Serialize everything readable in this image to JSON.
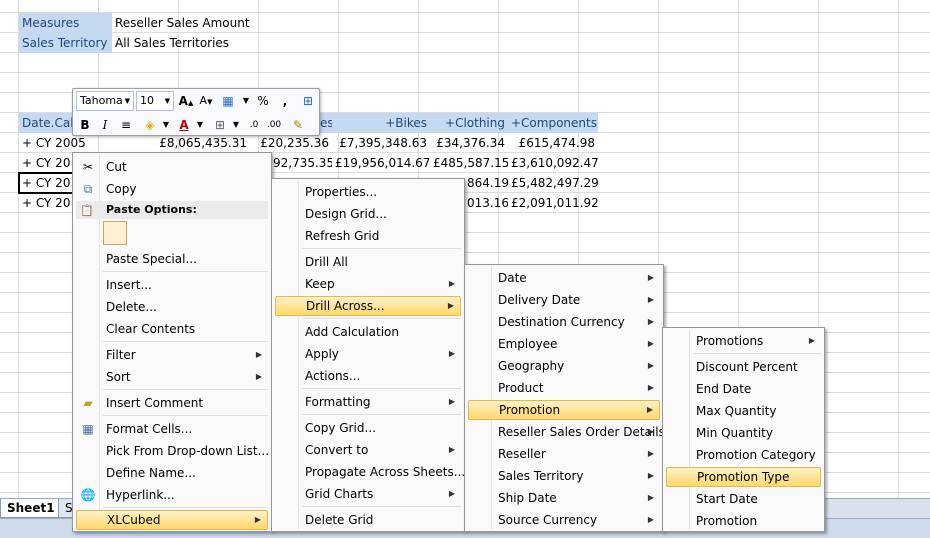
{
  "sheet": {
    "filters": [
      {
        "label": "Measures",
        "value": "Reseller Sales Amount"
      },
      {
        "label": "Sales Territory",
        "value": "All Sales Territories"
      }
    ],
    "header_row": {
      "date_label": "Date.Cale",
      "partial": "es",
      "cols": [
        "+Bikes",
        "+Clothing",
        "+Components"
      ]
    },
    "rows": [
      {
        "label": "+   CY 2005",
        "total": "£8,065,435.31",
        "c1": "£7,395,348.63",
        "c2": "£34,376.34",
        "c3": "£615,474.98"
      },
      {
        "label": "+   CY 20",
        "total": "92,735.35",
        "c1": "£19,956,014.67",
        "c2": "£485,587.15",
        "c3": "£3,610,092.47"
      },
      {
        "label": "+   CY 20",
        "total": "",
        "c1": "",
        "c2": "864.19",
        "c3": "£5,482,497.29"
      },
      {
        "label": "+   CY 20",
        "total": "",
        "c1": "",
        "c2": "013.16",
        "c3": "£2,091,011.92"
      }
    ],
    "partial_total_row1": "£20,235.36"
  },
  "tabs": {
    "active": "Sheet1",
    "other": "S"
  },
  "mini_toolbar": {
    "font": "Tahoma",
    "size": "10",
    "bold": "B",
    "italic": "I",
    "percent": "%",
    "comma": ","
  },
  "context_menu": {
    "cut": "Cut",
    "copy": "Copy",
    "paste_options": "Paste Options:",
    "paste_special": "Paste Special...",
    "insert": "Insert...",
    "delete": "Delete...",
    "clear": "Clear Contents",
    "filter": "Filter",
    "sort": "Sort",
    "insert_comment": "Insert Comment",
    "format_cells": "Format Cells...",
    "pick_list": "Pick From Drop-down List...",
    "define_name": "Define Name...",
    "hyperlink": "Hyperlink...",
    "xlcubed": "XLCubed"
  },
  "xlcubed_menu": {
    "properties": "Properties...",
    "design_grid": "Design Grid...",
    "refresh_grid": "Refresh Grid",
    "drill_all": "Drill All",
    "keep": "Keep",
    "drill_across": "Drill Across...",
    "add_calc": "Add Calculation",
    "apply": "Apply",
    "actions": "Actions...",
    "formatting": "Formatting",
    "copy_grid": "Copy Grid...",
    "convert_to": "Convert to",
    "propagate": "Propagate Across Sheets...",
    "grid_charts": "Grid Charts",
    "delete_grid": "Delete Grid"
  },
  "dimension_menu": {
    "items": [
      "Date",
      "Delivery Date",
      "Destination Currency",
      "Employee",
      "Geography",
      "Product",
      "Promotion",
      "Reseller Sales Order Details",
      "Reseller",
      "Sales Territory",
      "Ship Date",
      "Source Currency"
    ]
  },
  "promotion_menu": {
    "items": [
      "Promotions",
      "Discount Percent",
      "End Date",
      "Max Quantity",
      "Min Quantity",
      "Promotion Category",
      "Promotion Type",
      "Start Date",
      "Promotion"
    ]
  },
  "colors": {
    "highlight": "#ffd86b",
    "header_fill": "#c5d9f1"
  }
}
